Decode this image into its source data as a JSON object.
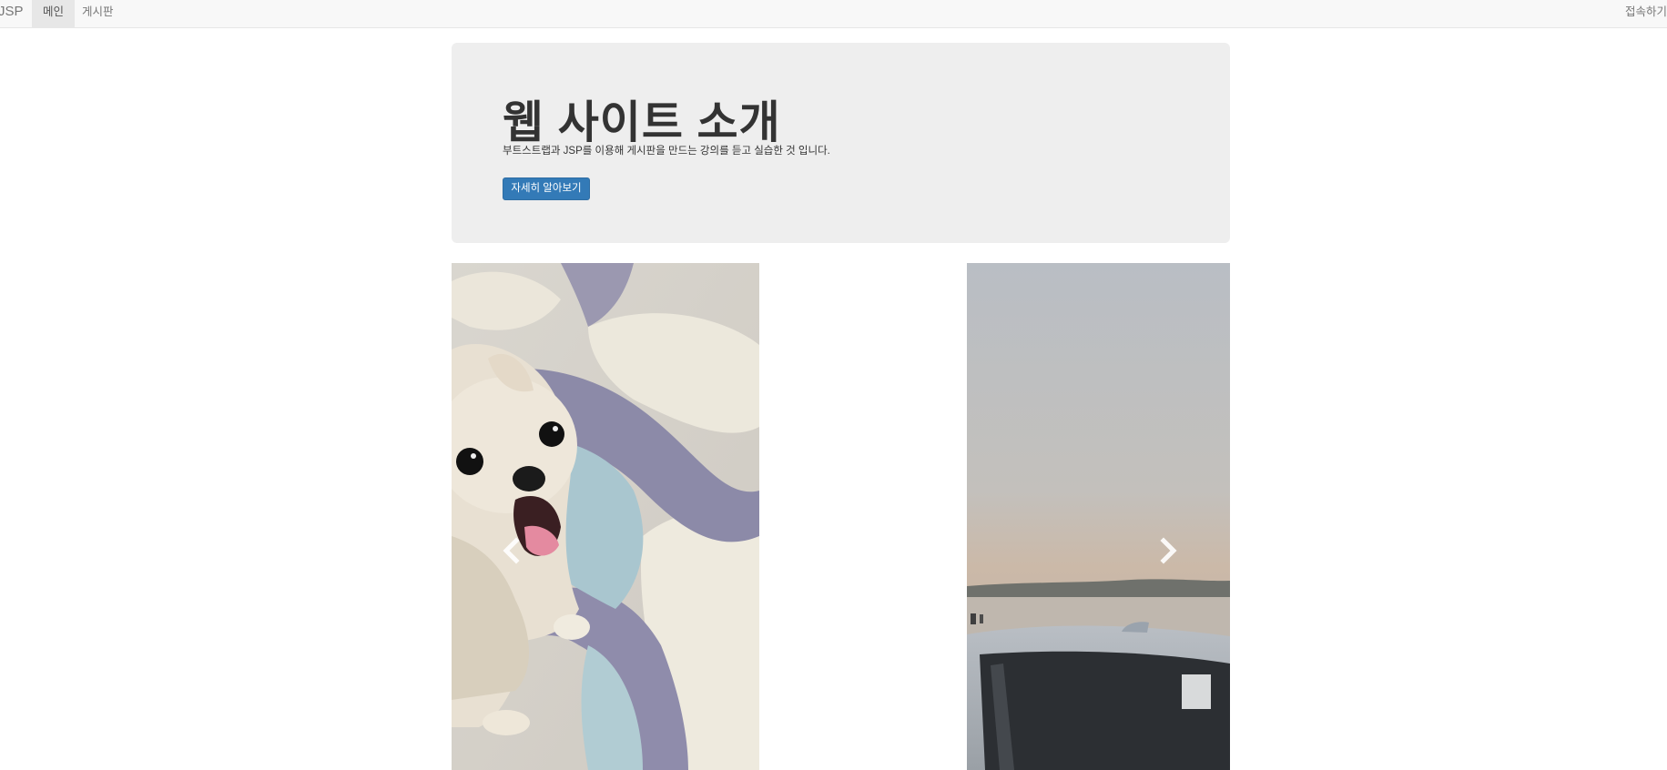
{
  "navbar": {
    "brand": "JSP",
    "items": [
      {
        "label": "메인",
        "active": true
      },
      {
        "label": "게시판",
        "active": false
      }
    ],
    "right_label": "접속하기"
  },
  "jumbotron": {
    "title": "웹 사이트 소개",
    "description": "부트스트랩과 JSP를 이용해 게시판을 만드는 강의를 듣고 실습한 것 입니다.",
    "button_label": "자세히 알아보기"
  },
  "carousel": {
    "slides": [
      {
        "subject": "dog-photo"
      },
      {
        "subject": "car-seaside-photo"
      }
    ],
    "prev_icon": "chevron-left-icon",
    "next_icon": "chevron-right-icon"
  },
  "colors": {
    "navbar_bg": "#f8f8f8",
    "jumbotron_bg": "#eeeeee",
    "primary_button": "#337ab7"
  }
}
